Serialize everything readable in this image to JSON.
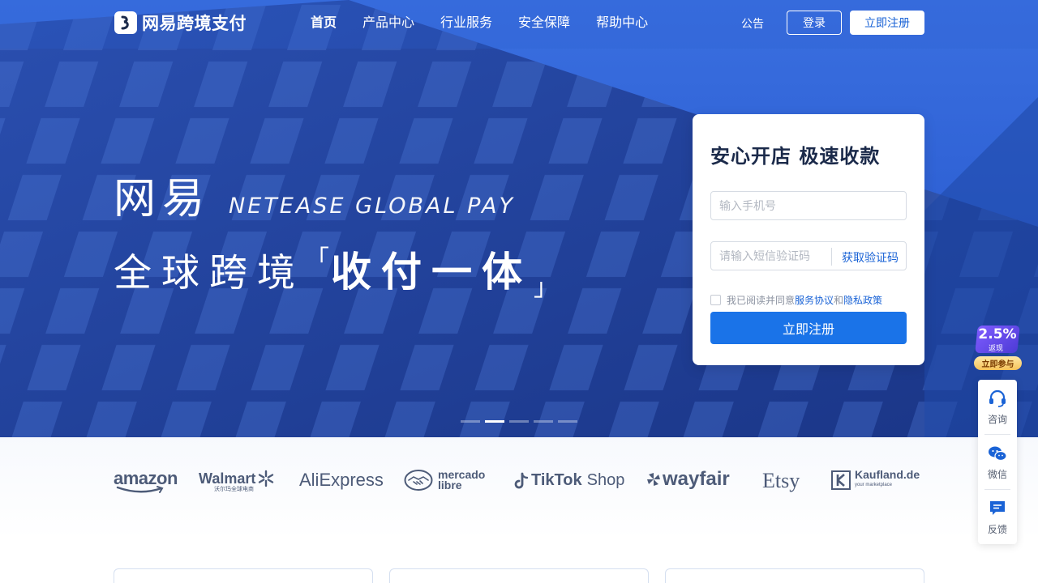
{
  "header": {
    "brand": "网易跨境支付",
    "nav": [
      "首页",
      "产品中心",
      "行业服务",
      "安全保障",
      "帮助中心"
    ],
    "notice": "公告",
    "login": "登录",
    "register": "立即注册"
  },
  "hero": {
    "brand_cn": "网易",
    "brand_en": "NETEASE GLOBAL PAY",
    "slogan_a": "全球跨境",
    "bracket_left": "「",
    "slogan_b": "收付一体",
    "bracket_right": "」"
  },
  "register_card": {
    "title": "安心开店 极速收款",
    "phone_placeholder": "输入手机号",
    "code_placeholder": "请输入短信验证码",
    "get_code": "获取验证码",
    "agree_prefix": "我已阅读并同意",
    "service_agreement": "服务协议",
    "and": "和",
    "privacy_policy": "隐私政策",
    "submit": "立即注册"
  },
  "carousel": {
    "count": 5,
    "active_index": 1
  },
  "partners": {
    "amazon": "amazon",
    "walmart": "Walmart",
    "walmart_sub": "沃尔玛全球电商",
    "aliexpress": "AliExpress",
    "mercado_line1": "mercado",
    "mercado_line2": "libre",
    "tiktok": "TikTok",
    "tiktok_shop": "Shop",
    "wayfair": "wayfair",
    "etsy": "Etsy",
    "kaufland": "Kaufland.de",
    "kaufland_sub": "your marketplace"
  },
  "promo": {
    "rate": "2.5%",
    "sub": "返现",
    "cta": "立即参与"
  },
  "side_panel": {
    "consult": "咨询",
    "wechat": "微信",
    "feedback": "反馈"
  },
  "colors": {
    "primary": "#1a73e8",
    "hero_dark": "#1d3f9d",
    "hero_light": "#2f5fd2",
    "text_dark": "#1b2a4a"
  }
}
